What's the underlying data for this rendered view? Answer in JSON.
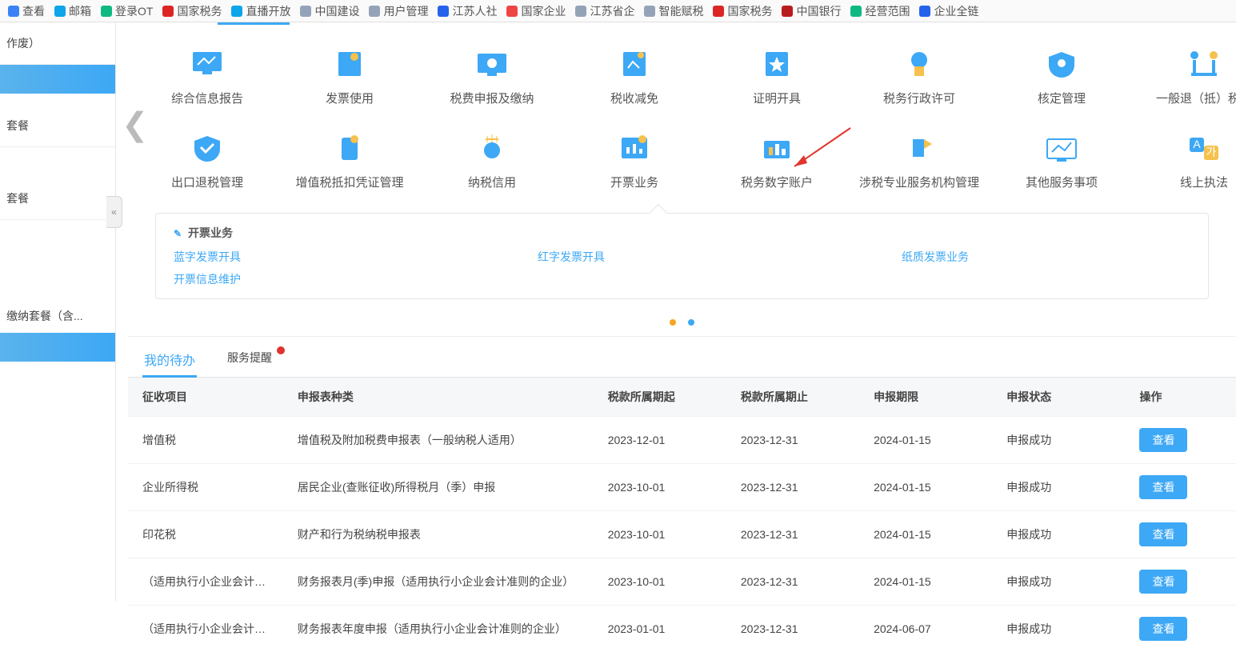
{
  "bookmarks": [
    {
      "label": "查看",
      "color": "#3b82f6"
    },
    {
      "label": "邮箱",
      "color": "#0ea5e9"
    },
    {
      "label": "登录OT",
      "color": "#10b981"
    },
    {
      "label": "国家税务",
      "color": "#dc2626"
    },
    {
      "label": "直播开放",
      "color": "#0ea5e9"
    },
    {
      "label": "中国建设",
      "color": "#94a3b8"
    },
    {
      "label": "用户管理",
      "color": "#94a3b8"
    },
    {
      "label": "江苏人社",
      "color": "#2563eb"
    },
    {
      "label": "国家企业",
      "color": "#ef4444"
    },
    {
      "label": "江苏省企",
      "color": "#94a3b8"
    },
    {
      "label": "智能赋税",
      "color": "#94a3b8"
    },
    {
      "label": "国家税务",
      "color": "#dc2626"
    },
    {
      "label": "中国银行",
      "color": "#b91c1c"
    },
    {
      "label": "经营范围",
      "color": "#10b981"
    },
    {
      "label": "企业全链",
      "color": "#2563eb"
    }
  ],
  "sidebar": {
    "items": [
      "作废）",
      "套餐",
      "套餐",
      "缴纳套餐（含..."
    ]
  },
  "modules_row1": [
    {
      "label": "综合信息报告"
    },
    {
      "label": "发票使用"
    },
    {
      "label": "税费申报及缴纳"
    },
    {
      "label": "税收减免"
    },
    {
      "label": "证明开具"
    },
    {
      "label": "税务行政许可"
    },
    {
      "label": "核定管理"
    },
    {
      "label": "一般退（抵）税管"
    }
  ],
  "modules_row2": [
    {
      "label": "出口退税管理"
    },
    {
      "label": "增值税抵扣凭证管理"
    },
    {
      "label": "纳税信用"
    },
    {
      "label": "开票业务"
    },
    {
      "label": "税务数字账户"
    },
    {
      "label": "涉税专业服务机构管理"
    },
    {
      "label": "其他服务事项"
    },
    {
      "label": "线上执法"
    }
  ],
  "subbox": {
    "title": "开票业务",
    "links_row1": [
      "蓝字发票开具",
      "红字发票开具",
      "纸质发票业务"
    ],
    "links_row2": [
      "开票信息维护"
    ]
  },
  "todo_tabs": {
    "active": "我的待办",
    "other": "服务提醒"
  },
  "todo_table": {
    "headers": [
      "征收项目",
      "申报表种类",
      "税款所属期起",
      "税款所属期止",
      "申报期限",
      "申报状态",
      "操作"
    ],
    "action_label": "查看",
    "rows": [
      {
        "c0": "增值税",
        "c1": "增值税及附加税费申报表（一般纳税人适用）",
        "c2": "2023-12-01",
        "c3": "2023-12-31",
        "c4": "2024-01-15",
        "c5": "申报成功"
      },
      {
        "c0": "企业所得税",
        "c1": "居民企业(查账征收)所得税月（季）申报",
        "c2": "2023-10-01",
        "c3": "2023-12-31",
        "c4": "2024-01-15",
        "c5": "申报成功"
      },
      {
        "c0": "印花税",
        "c1": "财产和行为税纳税申报表",
        "c2": "2023-10-01",
        "c3": "2023-12-31",
        "c4": "2024-01-15",
        "c5": "申报成功"
      },
      {
        "c0": "（适用执行小企业会计准则...",
        "c1": "财务报表月(季)申报（适用执行小企业会计准则的企业）",
        "c2": "2023-10-01",
        "c3": "2023-12-31",
        "c4": "2024-01-15",
        "c5": "申报成功"
      },
      {
        "c0": "（适用执行小企业会计准则...",
        "c1": "财务报表年度申报（适用执行小企业会计准则的企业）",
        "c2": "2023-01-01",
        "c3": "2023-12-31",
        "c4": "2024-06-07",
        "c5": "申报成功"
      }
    ]
  }
}
